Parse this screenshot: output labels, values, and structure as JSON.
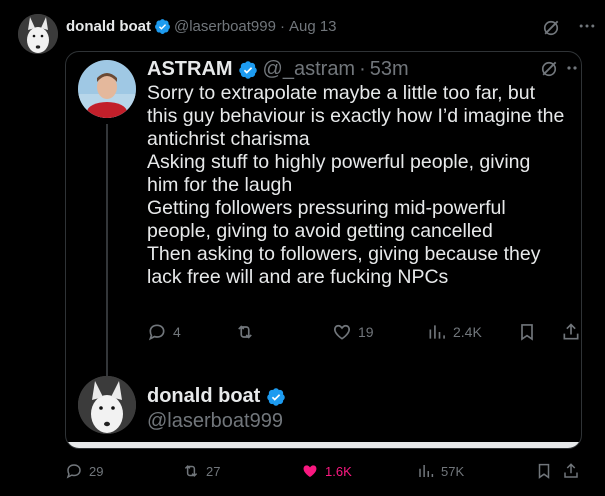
{
  "outer_tweet": {
    "author_name": "donald boat",
    "author_handle": "@laserboat999",
    "separator": "·",
    "date": "Aug 13",
    "icons": {
      "avatar": "dog-avatar",
      "verified": "verified-badge-icon",
      "grok": "grok-icon",
      "more": "more-icon"
    },
    "stats": {
      "replies": "29",
      "reposts": "27",
      "likes": "1.6K",
      "views": "57K"
    },
    "like_color": "#f91880"
  },
  "quoted_tweet": {
    "author_name": "ASTRAM",
    "author_handle": "@_astram",
    "separator": "·",
    "time": "53m",
    "text_lines": [
      "Sorry to extrapolate maybe a little too far, but",
      "this guy behaviour is exactly how I’d imagine the",
      "antichrist charisma",
      "Asking stuff to highly powerful people, giving",
      "him for the laugh",
      "Getting followers pressuring mid-powerful",
      "people, giving to avoid getting cancelled",
      "Then asking to followers, giving because they",
      "lack free will and are fucking NPCs"
    ],
    "stats": {
      "replies": "4",
      "reposts": "",
      "likes": "19",
      "views": "2.4K"
    }
  },
  "reply_preview": {
    "author_name": "donald boat",
    "author_handle": "@laserboat999"
  },
  "colors": {
    "background": "#000000",
    "text": "#e7e9ea",
    "muted": "#71767b",
    "verified": "#1d9bf0",
    "border": "#2f3336"
  }
}
